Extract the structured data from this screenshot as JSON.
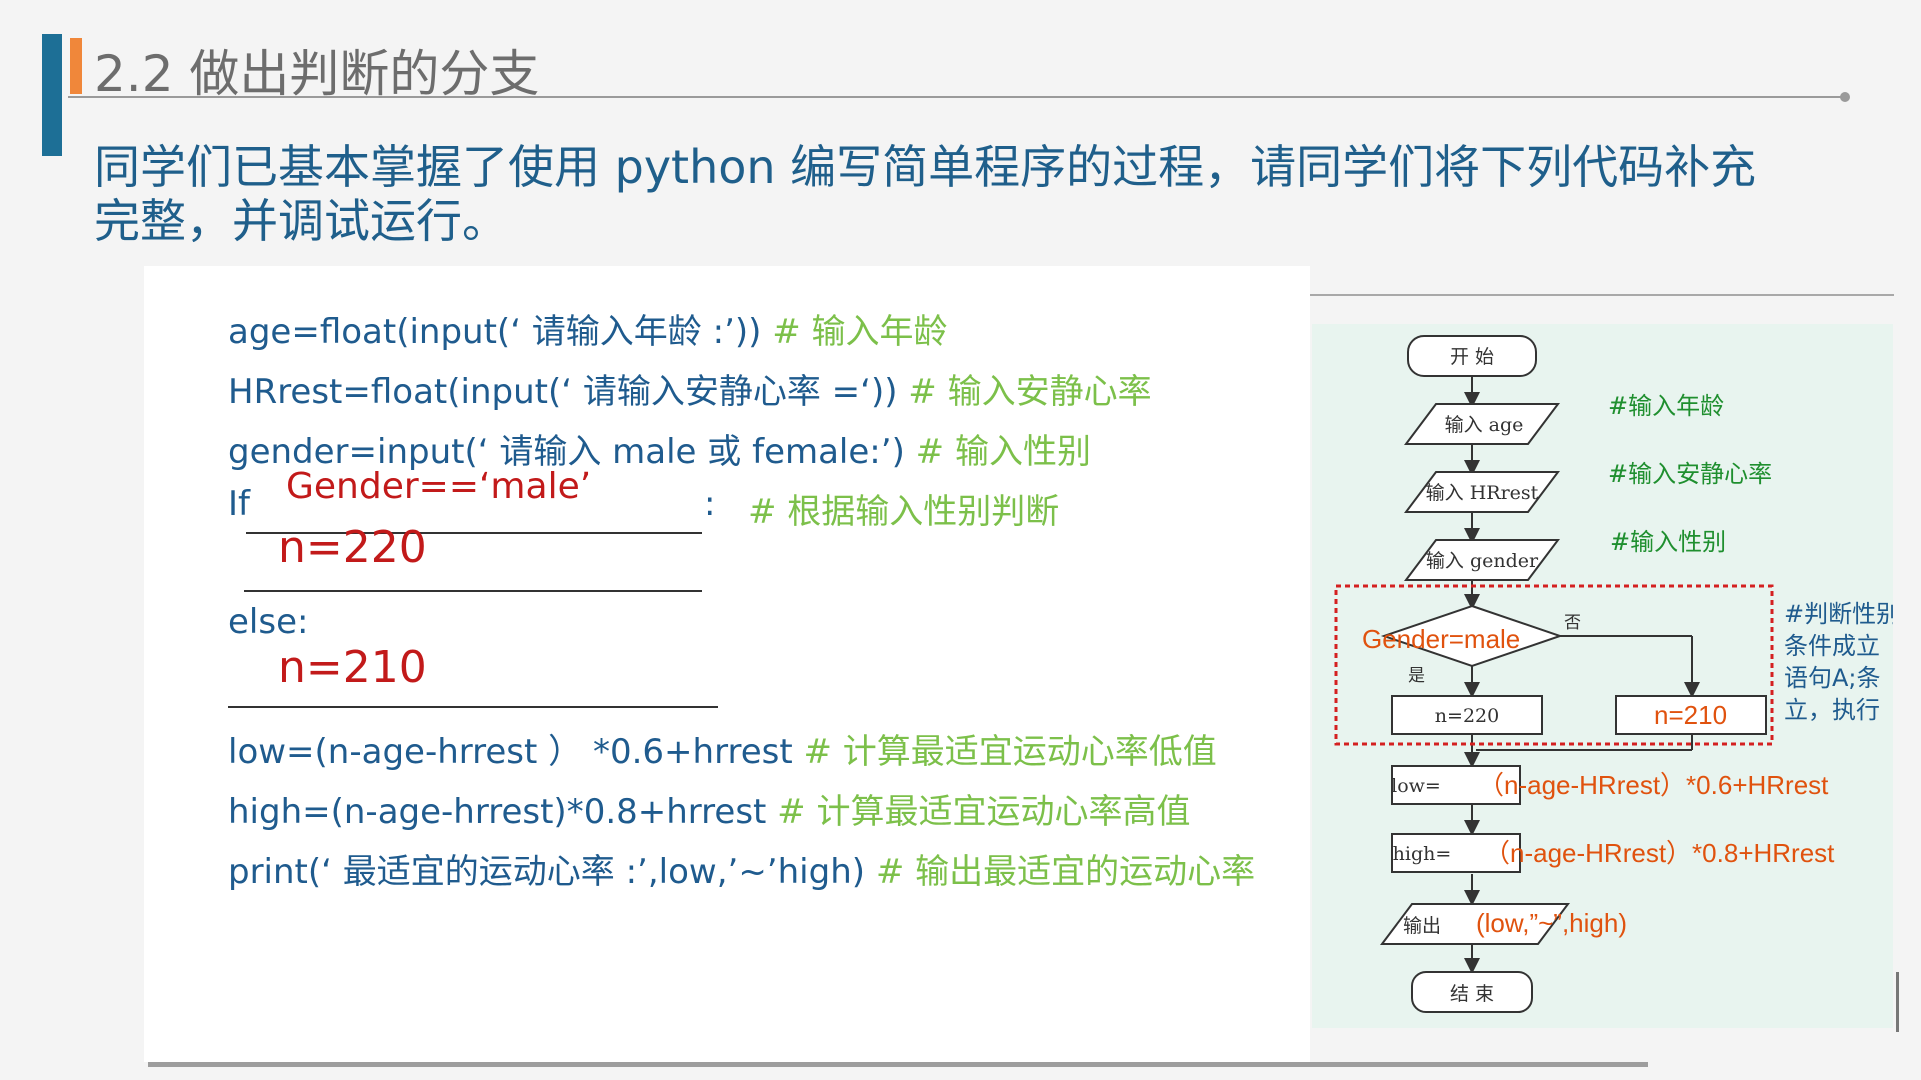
{
  "header": {
    "title": "2.2 做出判断的分支",
    "intro": "同学们已基本掌握了使用 python 编写简单程序的过程，请同学们将下列代码补充完整，并调试运行。"
  },
  "code": {
    "line1": {
      "code": "age=float(input(‘ 请输入年龄 :’))",
      "comment": " # 输入年龄"
    },
    "line2": {
      "code": "HRrest=float(input(‘ 请输入安静心率 =‘))",
      "comment": " # 输入安静心率"
    },
    "line3": {
      "code": "gender=input(‘ 请输入 male 或 female:’)",
      "comment": " # 输入性别"
    },
    "line4": {
      "prefix": "If",
      "colon": ":",
      "comment": "# 根据输入性别判断",
      "answer": "Gender==‘male’"
    },
    "answer_if_body": "n=220",
    "line_else": "else:",
    "answer_else_body": "n=210",
    "line_low": {
      "code": "low=(n-age-hrrest ） *0.6+hrrest",
      "comment": " # 计算最适宜运动心率低值"
    },
    "line_high": {
      "code": "high=(n-age-hrrest)*0.8+hrrest",
      "comment": "  # 计算最适宜运动心率高值"
    },
    "line_print": {
      "code": "print(‘ 最适宜的运动心率 :’,low,’~’high)",
      "comment": " # 输出最适宜的运动心率"
    }
  },
  "flowchart": {
    "start": "开 始",
    "input_age": "输入 age",
    "input_hrrest": "输入 HRrest",
    "input_gender": "输入 gender",
    "decision": "Gender=male",
    "yes": "是",
    "no": "否",
    "box_yes": "n=220",
    "box_no": "n=210",
    "low_prefix": "low=",
    "low_formula": "（n-age-HRrest）*0.6+HRrest",
    "high_prefix": "high=",
    "high_formula": "（n-age-HRrest）*0.8+HRrest",
    "output_prefix": "输出",
    "output_args": "(low,”~”,high)",
    "end": "结 束",
    "note_age": "#输入年龄",
    "note_hrrest": "#输入安静心率",
    "note_gender": "#输入性别",
    "note_judge_1": "#判断性别",
    "note_judge_2": "条件成立",
    "note_judge_3": "语句A;条",
    "note_judge_4": "立，执行"
  },
  "colors": {
    "title_gray": "#6d6d6d",
    "text_blue": "#1f5b8e",
    "comment_green": "#7cc04a",
    "answer_red": "#c21a1a",
    "flow_orange": "#e0520e",
    "flow_panel_bg": "#e8f4ef"
  }
}
